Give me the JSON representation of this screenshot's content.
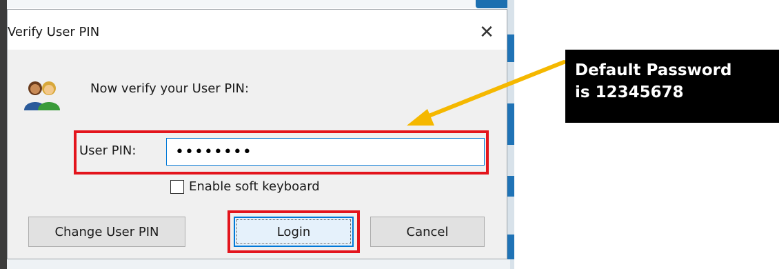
{
  "dialog": {
    "title": "Verify User PIN",
    "close_glyph": "✕",
    "prompt": "Now verify your User PIN:",
    "icon": "users-icon",
    "pin_label": "User PIN:",
    "pin_value": "••••••••",
    "soft_keyboard_label": "Enable soft keyboard",
    "soft_keyboard_checked": false,
    "buttons": {
      "change_pin": "Change User PIN",
      "login": "Login",
      "cancel": "Cancel"
    }
  },
  "annotation": {
    "line1": "Default Password",
    "line2": "is 12345678",
    "highlight_color": "#e3141c",
    "arrow_color": "#f5b800"
  },
  "colors": {
    "focus_accent": "#0078d7",
    "dialog_bg": "#f0f0f0"
  }
}
